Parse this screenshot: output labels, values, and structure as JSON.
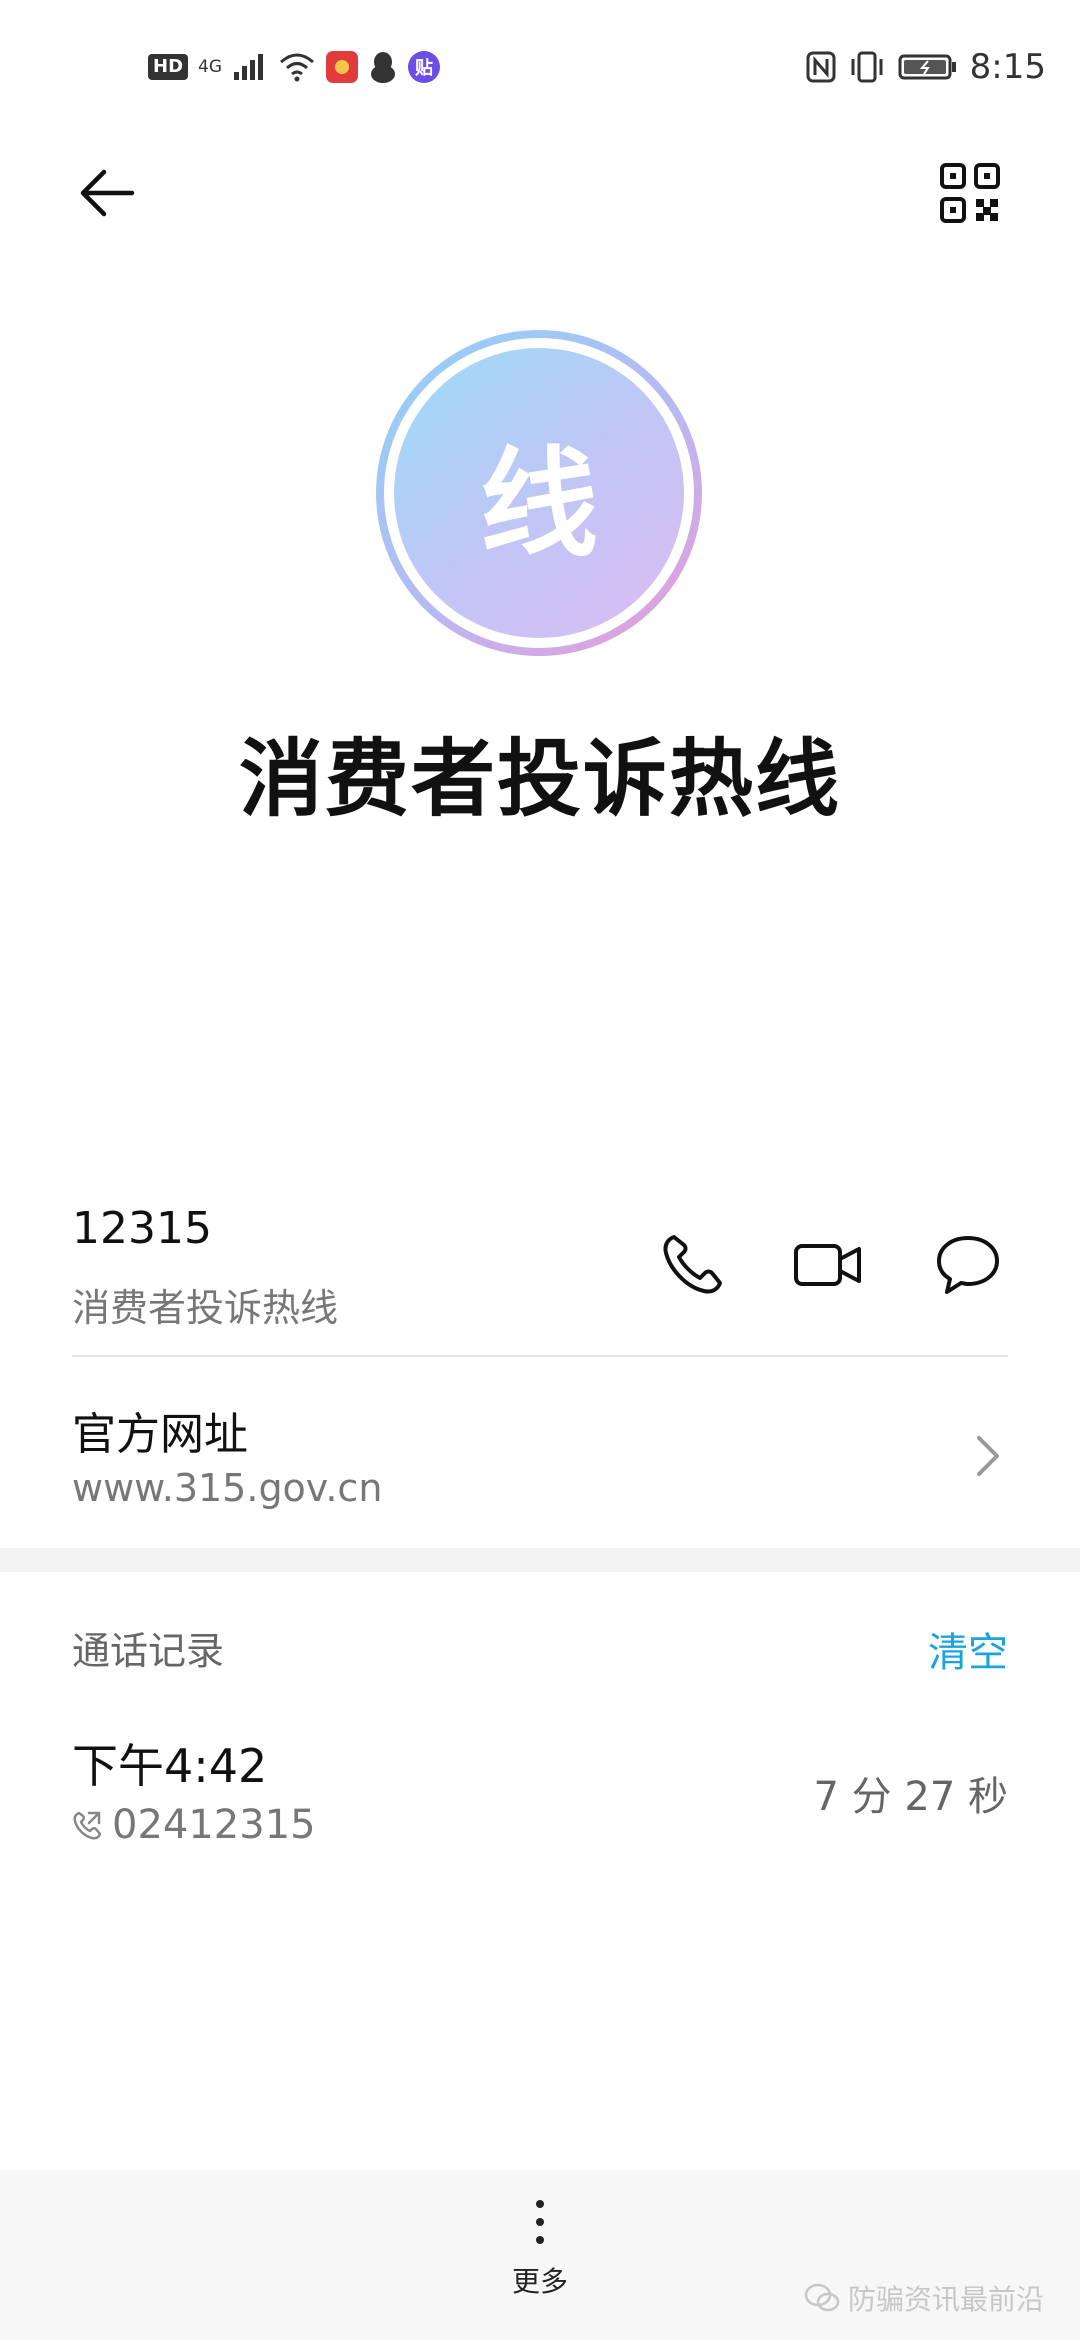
{
  "status_bar": {
    "hd": "HD",
    "network": "4G",
    "time": "8:15",
    "app_badge": "贴",
    "colors": {
      "app_red": "#e23b3b",
      "app_purple": "#6b4ee6"
    }
  },
  "contact": {
    "avatar_char": "线",
    "name": "消费者投诉热线"
  },
  "phone": {
    "number": "12315",
    "label": "消费者投诉热线"
  },
  "website": {
    "title": "官方网址",
    "url": "www.315.gov.cn"
  },
  "call_log": {
    "title": "通话记录",
    "clear_label": "清空",
    "entries": [
      {
        "time": "下午4:42",
        "number": "02412315",
        "duration": "7 分 27 秒"
      }
    ]
  },
  "bottom": {
    "more_label": "更多",
    "watermark": "防骗资讯最前沿"
  },
  "icons": {
    "back": "arrow-left-icon",
    "qr": "qr-code-icon",
    "call": "phone-icon",
    "video": "video-camera-icon",
    "message": "message-bubble-icon",
    "chevron": "chevron-right-icon",
    "outgoing_call": "outgoing-call-icon",
    "more": "more-vertical-icon"
  },
  "colors": {
    "accent": "#1aa3e0",
    "avatar_gradient_start": "#8fd3f7",
    "avatar_gradient_end": "#ea9ad7"
  }
}
